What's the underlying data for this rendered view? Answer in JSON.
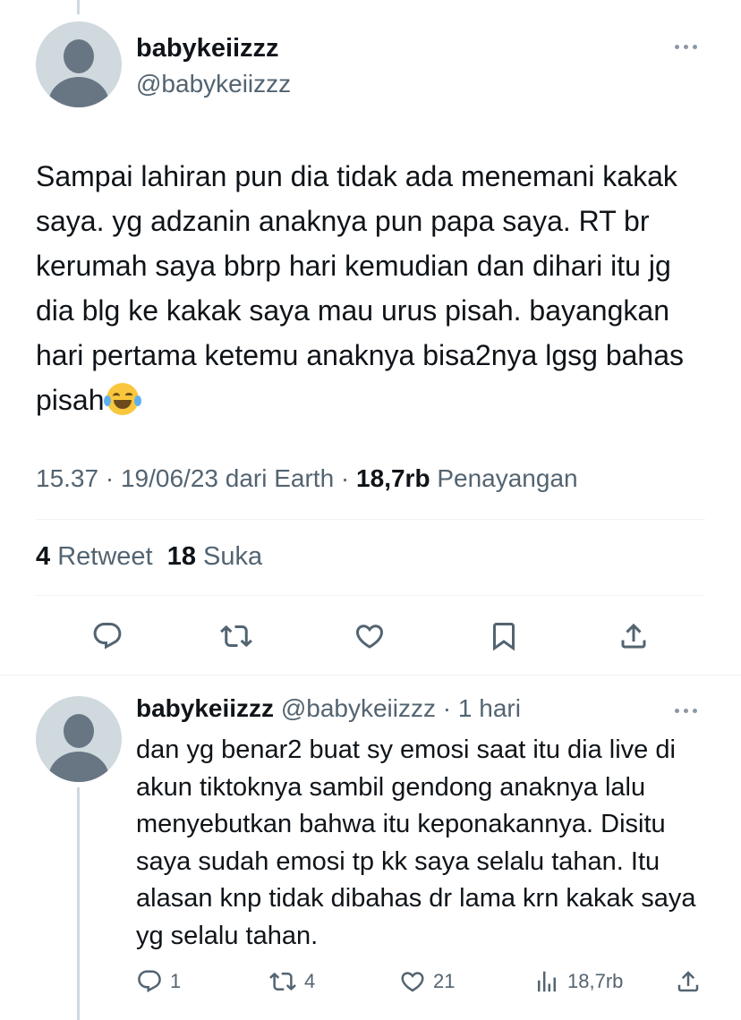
{
  "main_tweet": {
    "display_name": "babykeiizzz",
    "handle": "@babykeiizzz",
    "text": "Sampai lahiran pun dia tidak ada menemani kakak saya. yg adzanin anaknya pun papa saya. RT br kerumah saya bbrp hari kemudian dan dihari itu jg dia blg ke kakak saya mau urus pisah. bayangkan hari pertama ketemu anaknya bisa2nya lgsg bahas pisah",
    "emoji": "face-with-tears-of-joy",
    "time": "15.37",
    "date": "19/06/23",
    "source": "dari Earth",
    "views_count": "18,7rb",
    "views_label": "Penayangan",
    "retweets_count": "4",
    "retweets_label": "Retweet",
    "likes_count": "18",
    "likes_label": "Suka"
  },
  "reply_tweet": {
    "display_name": "babykeiizzz",
    "handle": "@babykeiizzz",
    "time_ago": "1 hari",
    "text": "dan yg benar2 buat sy emosi saat itu dia live di akun tiktoknya sambil gendong anaknya lalu menyebutkan bahwa itu keponakannya. Disitu saya sudah emosi tp kk saya selalu tahan. Itu alasan knp tidak dibahas dr lama krn kakak saya yg selalu tahan.",
    "reply_count": "1",
    "retweet_count": "4",
    "like_count": "21",
    "views_count": "18,7rb"
  },
  "icons": {
    "reply": "reply-icon",
    "retweet": "retweet-icon",
    "like": "heart-icon",
    "bookmark": "bookmark-icon",
    "share": "share-icon",
    "views": "views-icon",
    "more": "more-icon"
  },
  "colors": {
    "text_primary": "#0f1419",
    "text_secondary": "#536471",
    "divider": "#eff3f4",
    "avatar_bg": "#cfd9de",
    "avatar_fg": "#687684"
  }
}
